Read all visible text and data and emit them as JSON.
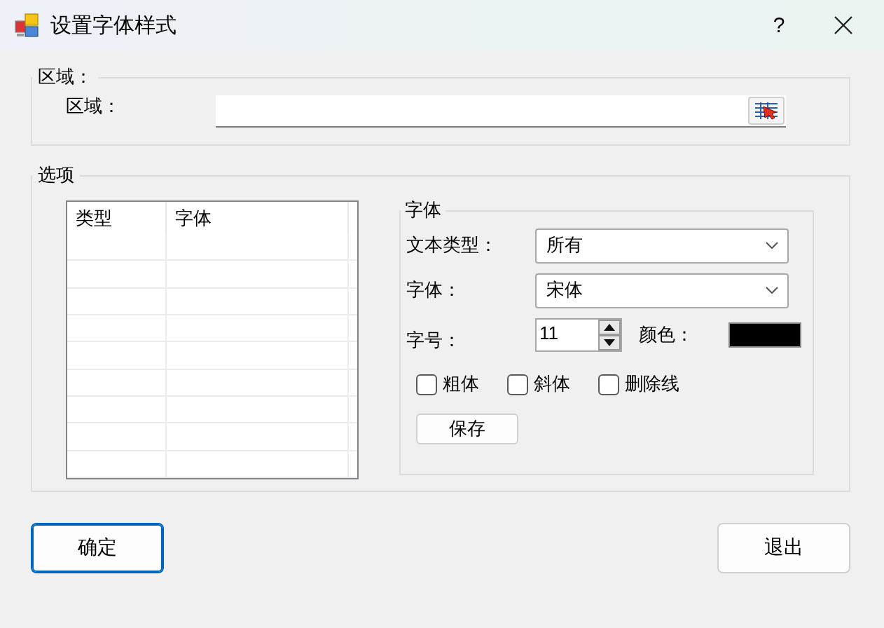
{
  "window": {
    "title": "设置字体样式",
    "help": "?"
  },
  "area_group": {
    "legend": "区域：",
    "label": "区域："
  },
  "options_group": {
    "legend": "选项",
    "table": {
      "columns": [
        "类型",
        "字体"
      ]
    },
    "font_group": {
      "legend": "字体",
      "text_type_label": "文本类型：",
      "text_type": "所有",
      "font_label": "字体：",
      "font": "宋体",
      "size_label": "字号：",
      "size": "11",
      "color_label": "颜色：",
      "color": "#000000",
      "checkboxes": [
        {
          "label": "粗体",
          "checked": false
        },
        {
          "label": "斜体",
          "checked": false
        },
        {
          "label": "删除线",
          "checked": false
        }
      ],
      "save": "保存"
    }
  },
  "buttons": [
    {
      "label": "确定",
      "selected": true
    },
    {
      "label": "退出",
      "selected": false
    }
  ]
}
